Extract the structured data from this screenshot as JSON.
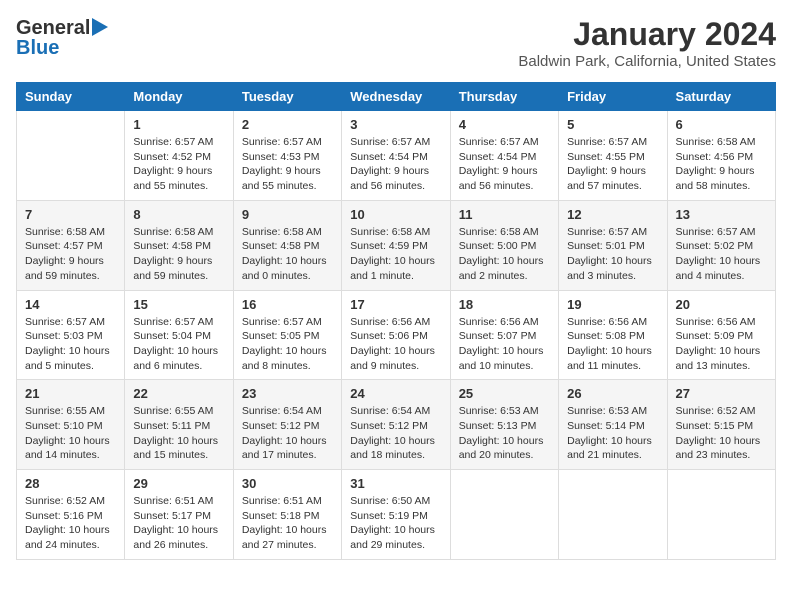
{
  "header": {
    "logo_general": "General",
    "logo_blue": "Blue",
    "title": "January 2024",
    "subtitle": "Baldwin Park, California, United States"
  },
  "calendar": {
    "columns": [
      "Sunday",
      "Monday",
      "Tuesday",
      "Wednesday",
      "Thursday",
      "Friday",
      "Saturday"
    ],
    "rows": [
      [
        {
          "day": "",
          "info": ""
        },
        {
          "day": "1",
          "info": "Sunrise: 6:57 AM\nSunset: 4:52 PM\nDaylight: 9 hours\nand 55 minutes."
        },
        {
          "day": "2",
          "info": "Sunrise: 6:57 AM\nSunset: 4:53 PM\nDaylight: 9 hours\nand 55 minutes."
        },
        {
          "day": "3",
          "info": "Sunrise: 6:57 AM\nSunset: 4:54 PM\nDaylight: 9 hours\nand 56 minutes."
        },
        {
          "day": "4",
          "info": "Sunrise: 6:57 AM\nSunset: 4:54 PM\nDaylight: 9 hours\nand 56 minutes."
        },
        {
          "day": "5",
          "info": "Sunrise: 6:57 AM\nSunset: 4:55 PM\nDaylight: 9 hours\nand 57 minutes."
        },
        {
          "day": "6",
          "info": "Sunrise: 6:58 AM\nSunset: 4:56 PM\nDaylight: 9 hours\nand 58 minutes."
        }
      ],
      [
        {
          "day": "7",
          "info": "Sunrise: 6:58 AM\nSunset: 4:57 PM\nDaylight: 9 hours\nand 59 minutes."
        },
        {
          "day": "8",
          "info": "Sunrise: 6:58 AM\nSunset: 4:58 PM\nDaylight: 9 hours\nand 59 minutes."
        },
        {
          "day": "9",
          "info": "Sunrise: 6:58 AM\nSunset: 4:58 PM\nDaylight: 10 hours\nand 0 minutes."
        },
        {
          "day": "10",
          "info": "Sunrise: 6:58 AM\nSunset: 4:59 PM\nDaylight: 10 hours\nand 1 minute."
        },
        {
          "day": "11",
          "info": "Sunrise: 6:58 AM\nSunset: 5:00 PM\nDaylight: 10 hours\nand 2 minutes."
        },
        {
          "day": "12",
          "info": "Sunrise: 6:57 AM\nSunset: 5:01 PM\nDaylight: 10 hours\nand 3 minutes."
        },
        {
          "day": "13",
          "info": "Sunrise: 6:57 AM\nSunset: 5:02 PM\nDaylight: 10 hours\nand 4 minutes."
        }
      ],
      [
        {
          "day": "14",
          "info": "Sunrise: 6:57 AM\nSunset: 5:03 PM\nDaylight: 10 hours\nand 5 minutes."
        },
        {
          "day": "15",
          "info": "Sunrise: 6:57 AM\nSunset: 5:04 PM\nDaylight: 10 hours\nand 6 minutes."
        },
        {
          "day": "16",
          "info": "Sunrise: 6:57 AM\nSunset: 5:05 PM\nDaylight: 10 hours\nand 8 minutes."
        },
        {
          "day": "17",
          "info": "Sunrise: 6:56 AM\nSunset: 5:06 PM\nDaylight: 10 hours\nand 9 minutes."
        },
        {
          "day": "18",
          "info": "Sunrise: 6:56 AM\nSunset: 5:07 PM\nDaylight: 10 hours\nand 10 minutes."
        },
        {
          "day": "19",
          "info": "Sunrise: 6:56 AM\nSunset: 5:08 PM\nDaylight: 10 hours\nand 11 minutes."
        },
        {
          "day": "20",
          "info": "Sunrise: 6:56 AM\nSunset: 5:09 PM\nDaylight: 10 hours\nand 13 minutes."
        }
      ],
      [
        {
          "day": "21",
          "info": "Sunrise: 6:55 AM\nSunset: 5:10 PM\nDaylight: 10 hours\nand 14 minutes."
        },
        {
          "day": "22",
          "info": "Sunrise: 6:55 AM\nSunset: 5:11 PM\nDaylight: 10 hours\nand 15 minutes."
        },
        {
          "day": "23",
          "info": "Sunrise: 6:54 AM\nSunset: 5:12 PM\nDaylight: 10 hours\nand 17 minutes."
        },
        {
          "day": "24",
          "info": "Sunrise: 6:54 AM\nSunset: 5:12 PM\nDaylight: 10 hours\nand 18 minutes."
        },
        {
          "day": "25",
          "info": "Sunrise: 6:53 AM\nSunset: 5:13 PM\nDaylight: 10 hours\nand 20 minutes."
        },
        {
          "day": "26",
          "info": "Sunrise: 6:53 AM\nSunset: 5:14 PM\nDaylight: 10 hours\nand 21 minutes."
        },
        {
          "day": "27",
          "info": "Sunrise: 6:52 AM\nSunset: 5:15 PM\nDaylight: 10 hours\nand 23 minutes."
        }
      ],
      [
        {
          "day": "28",
          "info": "Sunrise: 6:52 AM\nSunset: 5:16 PM\nDaylight: 10 hours\nand 24 minutes."
        },
        {
          "day": "29",
          "info": "Sunrise: 6:51 AM\nSunset: 5:17 PM\nDaylight: 10 hours\nand 26 minutes."
        },
        {
          "day": "30",
          "info": "Sunrise: 6:51 AM\nSunset: 5:18 PM\nDaylight: 10 hours\nand 27 minutes."
        },
        {
          "day": "31",
          "info": "Sunrise: 6:50 AM\nSunset: 5:19 PM\nDaylight: 10 hours\nand 29 minutes."
        },
        {
          "day": "",
          "info": ""
        },
        {
          "day": "",
          "info": ""
        },
        {
          "day": "",
          "info": ""
        }
      ]
    ]
  }
}
